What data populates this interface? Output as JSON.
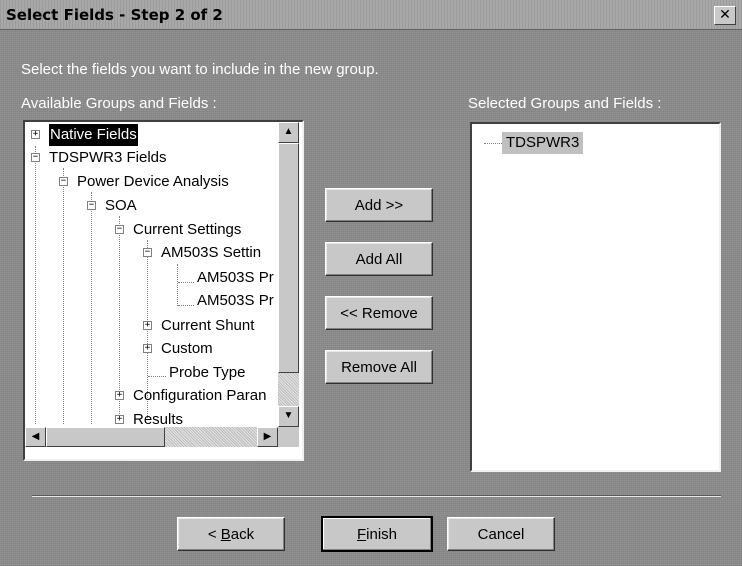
{
  "window": {
    "title": "Select Fields - Step 2 of 2",
    "close_glyph": "✕"
  },
  "instruction": "Select the fields you want to include in the new group.",
  "available": {
    "label": "Available Groups and Fields :",
    "nodes": [
      {
        "label": "Native Fields",
        "expander": "+",
        "selected": true
      },
      {
        "label": "TDSPWR3 Fields",
        "expander": "−"
      },
      {
        "label": "Power Device Analysis",
        "expander": "−"
      },
      {
        "label": "SOA",
        "expander": "−"
      },
      {
        "label": "Current Settings",
        "expander": "−"
      },
      {
        "label": "AM503S Settin",
        "expander": "−"
      },
      {
        "label": "AM503S Pr",
        "expander": ""
      },
      {
        "label": "AM503S Pr",
        "expander": ""
      },
      {
        "label": "Current Shunt",
        "expander": "+"
      },
      {
        "label": "Custom",
        "expander": "+"
      },
      {
        "label": "Probe Type",
        "expander": ""
      },
      {
        "label": "Configuration Paran",
        "expander": "+"
      },
      {
        "label": "Results",
        "expander": "+"
      }
    ]
  },
  "selected": {
    "label": "Selected Groups and Fields :",
    "items": [
      {
        "label": "TDSPWR3"
      }
    ]
  },
  "actions": {
    "add": "Add >>",
    "add_all": "Add All",
    "remove": "<< Remove",
    "remove_all": "Remove All"
  },
  "footer": {
    "back": "< Back",
    "back_prefix": "< ",
    "back_mnemonic": "B",
    "back_rest": "ack",
    "finish_mnemonic": "F",
    "finish_rest": "inish",
    "cancel": "Cancel"
  },
  "scroll": {
    "up": "▲",
    "down": "▼",
    "left": "◀",
    "right": "▶"
  }
}
